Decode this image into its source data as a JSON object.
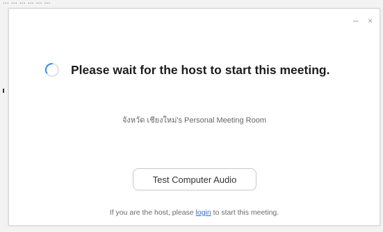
{
  "background": {
    "text": "... ... ... ... ... ..."
  },
  "window": {
    "minimize_glyph": "–",
    "close_glyph": "×"
  },
  "status": {
    "title": "Please wait for the host to start this meeting.",
    "room_name": "จังหวัด เชียงใหม่'s Personal Meeting Room"
  },
  "actions": {
    "test_audio_label": "Test Computer Audio"
  },
  "host_hint": {
    "before": "If you are the host, please ",
    "link": "login",
    "after": " to start this meeting."
  },
  "colors": {
    "link": "#2d6fd1",
    "spinner": "#2d8cff"
  },
  "icons": {
    "spinner": "loading-spinner-icon"
  }
}
